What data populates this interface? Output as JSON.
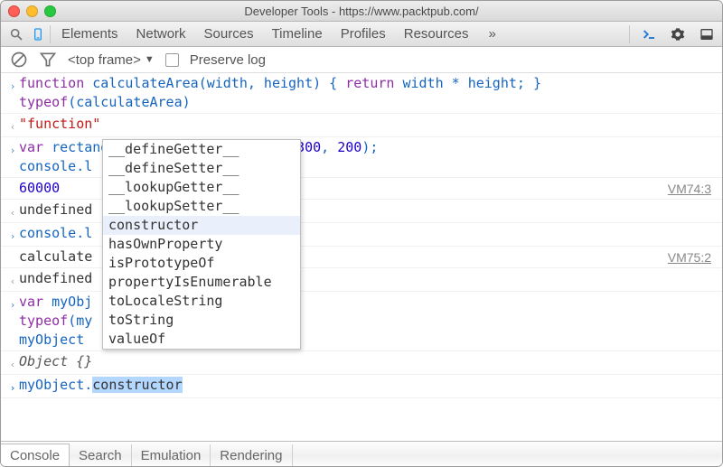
{
  "window": {
    "title": "Developer Tools - https://www.packtpub.com/"
  },
  "toolbar": {
    "tabs": [
      "Elements",
      "Network",
      "Sources",
      "Timeline",
      "Profiles",
      "Resources"
    ],
    "overflow": "»"
  },
  "subtoolbar": {
    "frame": "<top frame>",
    "preserve_log_label": "Preserve log"
  },
  "console_rows": [
    {
      "gutter": "input",
      "glyph": "›",
      "tokens": [
        {
          "t": "kw",
          "v": "function "
        },
        {
          "t": "fn",
          "v": "calculateArea"
        },
        {
          "t": "id",
          "v": "(width, height) { "
        },
        {
          "t": "kw",
          "v": "return"
        },
        {
          "t": "id",
          "v": " width * height; }\n"
        },
        {
          "t": "kw",
          "v": "typeof"
        },
        {
          "t": "id",
          "v": "(calculateArea)"
        }
      ]
    },
    {
      "gutter": "output",
      "glyph": "‹",
      "tokens": [
        {
          "t": "str",
          "v": "\"function\""
        }
      ]
    },
    {
      "gutter": "input",
      "glyph": "›",
      "tokens": [
        {
          "t": "kw",
          "v": "var"
        },
        {
          "t": "id",
          "v": " rectangleArea = calculateArea("
        },
        {
          "t": "num",
          "v": "300"
        },
        {
          "t": "id",
          "v": ", "
        },
        {
          "t": "num",
          "v": "200"
        },
        {
          "t": "id",
          "v": ");\n"
        },
        {
          "t": "id",
          "v": "console.l"
        }
      ]
    },
    {
      "gutter": "plain",
      "glyph": " ",
      "src": "VM74:3",
      "tokens": [
        {
          "t": "num",
          "v": "60000"
        }
      ]
    },
    {
      "gutter": "output",
      "glyph": "‹",
      "tokens": [
        {
          "t": "plain",
          "v": "undefined"
        }
      ]
    },
    {
      "gutter": "input",
      "glyph": "›",
      "tokens": [
        {
          "t": "id",
          "v": "console.l"
        }
      ]
    },
    {
      "gutter": "plain",
      "glyph": " ",
      "src": "VM75:2",
      "tokens": [
        {
          "t": "plain",
          "v": "calculate"
        }
      ]
    },
    {
      "gutter": "output",
      "glyph": "‹",
      "tokens": [
        {
          "t": "plain",
          "v": "undefined"
        }
      ]
    },
    {
      "gutter": "input",
      "glyph": "›",
      "tokens": [
        {
          "t": "kw",
          "v": "var"
        },
        {
          "t": "id",
          "v": " myObj\n"
        },
        {
          "t": "kw",
          "v": "typeof"
        },
        {
          "t": "id",
          "v": "(my\n"
        },
        {
          "t": "id",
          "v": "myObject"
        }
      ]
    },
    {
      "gutter": "output",
      "glyph": "‹",
      "tokens": [
        {
          "t": "obj",
          "v": "Object {}"
        }
      ]
    },
    {
      "gutter": "input",
      "glyph": "›",
      "tokens": [
        {
          "t": "caret",
          "v": "> "
        },
        {
          "t": "id",
          "v": "myObject."
        },
        {
          "t": "sel",
          "v": "constructor"
        }
      ],
      "indent_override": true
    }
  ],
  "autocomplete": {
    "items": [
      "__defineGetter__",
      "__defineSetter__",
      "__lookupGetter__",
      "__lookupSetter__",
      "constructor",
      "hasOwnProperty",
      "isPrototypeOf",
      "propertyIsEnumerable",
      "toLocaleString",
      "toString",
      "valueOf"
    ],
    "selected_index": 4
  },
  "drawer": {
    "tabs": [
      "Console",
      "Search",
      "Emulation",
      "Rendering"
    ],
    "active_index": 0
  }
}
